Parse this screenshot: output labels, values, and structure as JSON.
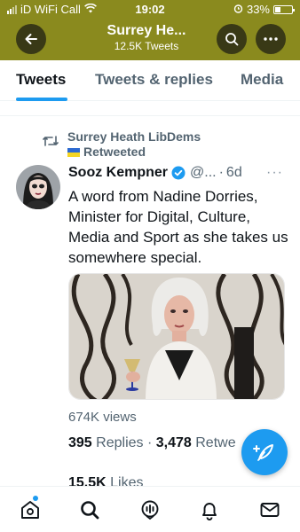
{
  "status_bar": {
    "carrier": "iD WiFi Call",
    "time": "19:02",
    "battery": "33%",
    "battery_level": 0.33
  },
  "header": {
    "title": "Surrey He...",
    "subtitle": "12.5K Tweets",
    "background_color": "#8a8a1e"
  },
  "tabs": [
    {
      "label": "Tweets",
      "active": true
    },
    {
      "label": "Tweets & replies",
      "active": false
    },
    {
      "label": "Media",
      "active": false
    }
  ],
  "retweet_context": {
    "line1": "Surrey Heath LibDems",
    "line2": "Retweeted"
  },
  "tweet": {
    "author": "Sooz Kempner",
    "handle": "@...",
    "separator": "·",
    "time": "6d",
    "more": "···",
    "text": "A word from Nadine Dorries, Minister for Digital, Culture, Media and Sport as she takes us somewhere special.",
    "views": "674K views",
    "replies_count": "395",
    "replies_label": "Replies",
    "stats_separator": "·",
    "retweets_count": "3,478",
    "retweets_label": "Retwe",
    "likes_count": "15.5K",
    "likes_label": "Likes"
  },
  "icons": {
    "back": "arrow-left-icon",
    "search": "search-icon",
    "more": "more-horizontal-icon",
    "retweet": "retweet-icon",
    "verified": "verified-badge-icon",
    "compose": "feather-plus-icon",
    "nav": [
      "home-icon",
      "search-icon",
      "spaces-icon",
      "bell-icon",
      "mail-icon"
    ]
  },
  "colors": {
    "accent": "#1d9bf0",
    "text_primary": "#0f1419",
    "text_secondary": "#536471"
  }
}
